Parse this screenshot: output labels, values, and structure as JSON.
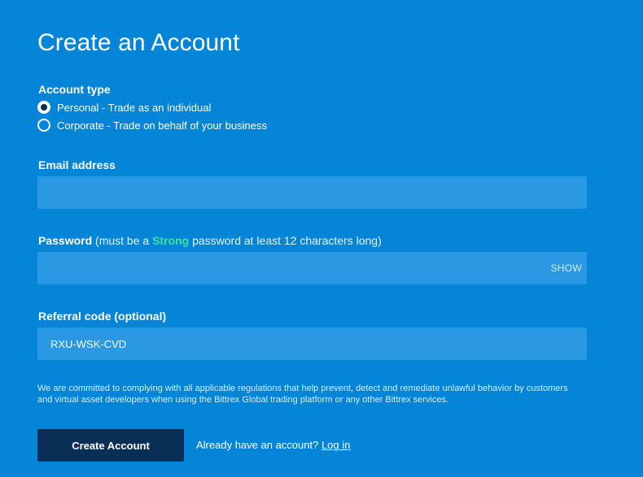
{
  "page": {
    "title": "Create an Account"
  },
  "account_type": {
    "label": "Account type",
    "options": [
      {
        "label": "Personal - Trade as an individual",
        "selected": true
      },
      {
        "label": "Corporate - Trade on behalf of your business",
        "selected": false
      }
    ]
  },
  "email": {
    "label": "Email address",
    "value": "",
    "placeholder": ""
  },
  "password": {
    "label": "Password",
    "hint_prefix": "(must be a",
    "hint_strong": "Strong",
    "hint_suffix": "password at least 12 characters long)",
    "value": "",
    "show_label": "SHOW"
  },
  "referral": {
    "label": "Referral code (optional)",
    "value": "RXU-WSK-CVD"
  },
  "disclaimer": "We are committed to complying with all applicable regulations that help prevent, detect and remediate unlawful behavior by customers and virtual asset developers when using the Bittrex Global trading platform or any other Bittrex services.",
  "actions": {
    "create_label": "Create Account",
    "have_account_text": "Already have an account?",
    "login_link": "Log in"
  },
  "colors": {
    "background": "#0585d7",
    "input_bg": "#2a98e3",
    "button_bg": "#0a2f57",
    "strong_accent": "#40e0a0"
  }
}
